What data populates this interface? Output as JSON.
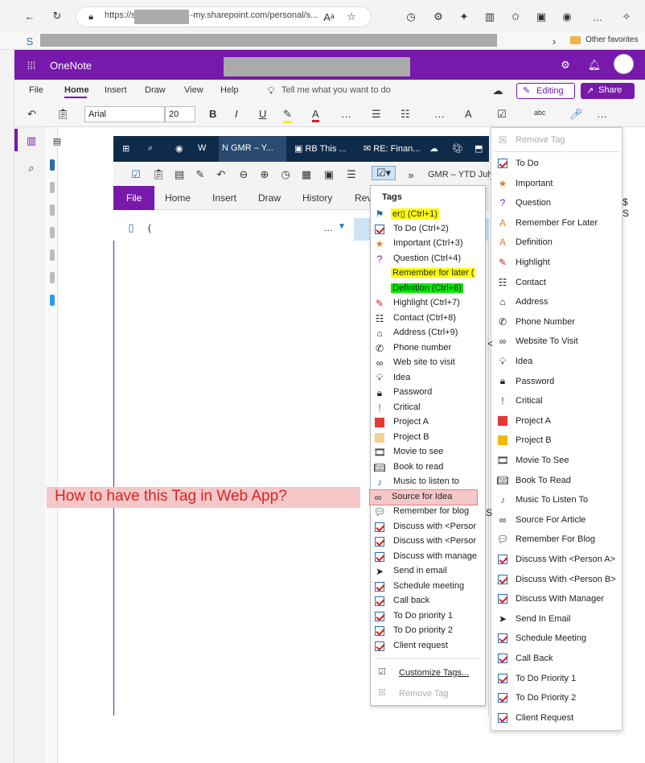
{
  "browser": {
    "url_prefix": "https://s",
    "url_suffix": "-my.sharepoint.com/personal/s...",
    "favorites_label": "Other favorites"
  },
  "app": {
    "name": "OneNote",
    "tabs": [
      "File",
      "Home",
      "Insert",
      "Draw",
      "View",
      "Help"
    ],
    "search_placeholder": "Tell me what you want to do",
    "editing_label": "Editing",
    "share_label": "Share",
    "font_name": "Arial",
    "font_size": "20"
  },
  "desktop": {
    "taskbar": [
      "GMR – Y...",
      "RB This ...",
      "RE: Finan..."
    ],
    "tabs": [
      "File",
      "Home",
      "Insert",
      "Draw",
      "History",
      "Rev"
    ],
    "notebook_title": "GMR – YTD July",
    "page_marker": "(",
    "tags_menu": {
      "title": "Tags",
      "items": [
        {
          "label": "er▯ (Ctrl+1)",
          "icon": "flag-icon",
          "highlight": "yellow"
        },
        {
          "label": "To Do (Ctrl+2)",
          "icon": "checkbox-icon"
        },
        {
          "label": "Important (Ctrl+3)",
          "icon": "star-icon"
        },
        {
          "label": "Question (Ctrl+4)",
          "icon": "question-icon"
        },
        {
          "label": "Remember for later (",
          "icon": "",
          "highlight": "yellow"
        },
        {
          "label": "Definition (Ctrl+6)",
          "icon": "",
          "highlight": "green"
        },
        {
          "label": "Highlight (Ctrl+7)",
          "icon": "highlighter-icon"
        },
        {
          "label": "Contact (Ctrl+8)",
          "icon": "contact-icon"
        },
        {
          "label": "Address (Ctrl+9)",
          "icon": "home-icon"
        },
        {
          "label": "Phone number",
          "icon": "phone-icon"
        },
        {
          "label": "Web site to visit",
          "icon": "link-icon"
        },
        {
          "label": "Idea",
          "icon": "bulb-icon"
        },
        {
          "label": "Password",
          "icon": "lock-icon"
        },
        {
          "label": "Critical",
          "icon": "exclamation-icon"
        },
        {
          "label": "Project A",
          "icon": "square-red-icon"
        },
        {
          "label": "Project B",
          "icon": "square-peach-icon"
        },
        {
          "label": "Movie to see",
          "icon": "film-icon"
        },
        {
          "label": "Book to read",
          "icon": "book-icon"
        },
        {
          "label": "Music to listen to",
          "icon": "music-icon"
        },
        {
          "label": "Source for Idea",
          "icon": "link-icon",
          "highlight": "pink"
        },
        {
          "label": "Remember for blog",
          "icon": "chat-icon"
        },
        {
          "label": "Discuss with <Persor",
          "icon": "checkbox-icon"
        },
        {
          "label": "Discuss with <Persor",
          "icon": "checkbox-icon"
        },
        {
          "label": "Discuss with manage",
          "icon": "checkbox-icon"
        },
        {
          "label": "Send in email",
          "icon": "send-icon"
        },
        {
          "label": "Schedule meeting",
          "icon": "checkbox-icon"
        },
        {
          "label": "Call back",
          "icon": "checkbox-icon"
        },
        {
          "label": "To Do priority 1",
          "icon": "checkbox-icon"
        },
        {
          "label": "To Do priority 2",
          "icon": "checkbox-icon"
        },
        {
          "label": "Client request",
          "icon": "checkbox-icon"
        }
      ],
      "customize": "Customize Tags...",
      "remove": "Remove Tag"
    }
  },
  "callout": "How to have this Tag in Web App?",
  "web_tags": {
    "remove": "Remove Tag",
    "items": [
      {
        "label": "To Do",
        "icon": "checkbox-icon"
      },
      {
        "label": "Important",
        "icon": "star-icon"
      },
      {
        "label": "Question",
        "icon": "question-icon"
      },
      {
        "label": "Remember For Later",
        "icon": "text-a-icon"
      },
      {
        "label": "Definition",
        "icon": "text-a-icon"
      },
      {
        "label": "Highlight",
        "icon": "highlighter-icon"
      },
      {
        "label": "Contact",
        "icon": "contact-icon"
      },
      {
        "label": "Address",
        "icon": "home-icon"
      },
      {
        "label": "Phone Number",
        "icon": "phone-icon"
      },
      {
        "label": "Website To Visit",
        "icon": "link-icon"
      },
      {
        "label": "Idea",
        "icon": "bulb-icon"
      },
      {
        "label": "Password",
        "icon": "lock-icon"
      },
      {
        "label": "Critical",
        "icon": "exclamation-icon"
      },
      {
        "label": "Project A",
        "icon": "square-red-icon"
      },
      {
        "label": "Project B",
        "icon": "square-orange-icon"
      },
      {
        "label": "Movie To See",
        "icon": "film-icon"
      },
      {
        "label": "Book To Read",
        "icon": "book-icon"
      },
      {
        "label": "Music To Listen To",
        "icon": "music-icon"
      },
      {
        "label": "Source For Article",
        "icon": "link-icon"
      },
      {
        "label": "Remember For Blog",
        "icon": "chat-icon"
      },
      {
        "label": "Discuss With <Person A>",
        "icon": "checkbox-icon"
      },
      {
        "label": "Discuss With <Person B>",
        "icon": "checkbox-icon"
      },
      {
        "label": "Discuss With Manager",
        "icon": "checkbox-icon"
      },
      {
        "label": "Send In Email",
        "icon": "send-icon"
      },
      {
        "label": "Schedule Meeting",
        "icon": "checkbox-icon"
      },
      {
        "label": "Call Back",
        "icon": "checkbox-icon"
      },
      {
        "label": "To Do Priority 1",
        "icon": "checkbox-icon"
      },
      {
        "label": "To Do Priority 2",
        "icon": "checkbox-icon"
      },
      {
        "label": "Client Request",
        "icon": "checkbox-icon"
      }
    ]
  },
  "colors": {
    "accent": "#7719aa",
    "callout_text": "#e02020",
    "callout_bg": "#f4c8c8"
  }
}
